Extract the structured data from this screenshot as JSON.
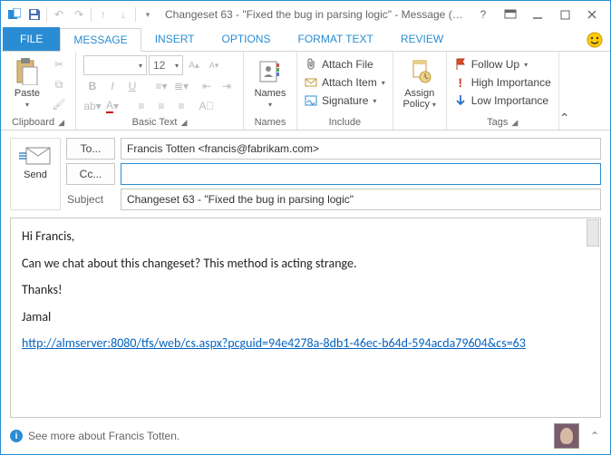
{
  "titlebar": {
    "title": "Changeset 63 - \"Fixed the bug in parsing logic\" - Message (H..."
  },
  "tabs": {
    "file": "FILE",
    "message": "MESSAGE",
    "insert": "INSERT",
    "options": "OPTIONS",
    "format": "FORMAT TEXT",
    "review": "REVIEW"
  },
  "ribbon": {
    "clipboard": {
      "paste": "Paste",
      "label": "Clipboard"
    },
    "basictext": {
      "font_size": "12",
      "label": "Basic Text"
    },
    "names": {
      "names": "Names",
      "label": "Names"
    },
    "include": {
      "attach_file": "Attach File",
      "attach_item": "Attach Item",
      "signature": "Signature",
      "label": "Include"
    },
    "assign": {
      "label_line1": "Assign",
      "label_line2": "Policy"
    },
    "tags": {
      "follow_up": "Follow Up",
      "high": "High Importance",
      "low": "Low Importance",
      "label": "Tags"
    }
  },
  "compose": {
    "send": "Send",
    "to_btn": "To...",
    "cc_btn": "Cc...",
    "subject_btn": "Subject",
    "to_value": "Francis Totten <francis@fabrikam.com>",
    "cc_value": "",
    "cc_placeholder": "",
    "subject_value": "Changeset 63 - \"Fixed the bug in parsing logic\""
  },
  "body_text": {
    "p1": "Hi Francis,",
    "p2": "Can we chat about this changeset? This method is acting strange.",
    "p3": "Thanks!",
    "p4": "Jamal",
    "link": "http://almserver:8080/tfs/web/cs.aspx?pcguid=94e4278a-8db1-46ec-b64d-594acda79604&cs=63"
  },
  "footer": {
    "text": "See more about Francis Totten."
  }
}
